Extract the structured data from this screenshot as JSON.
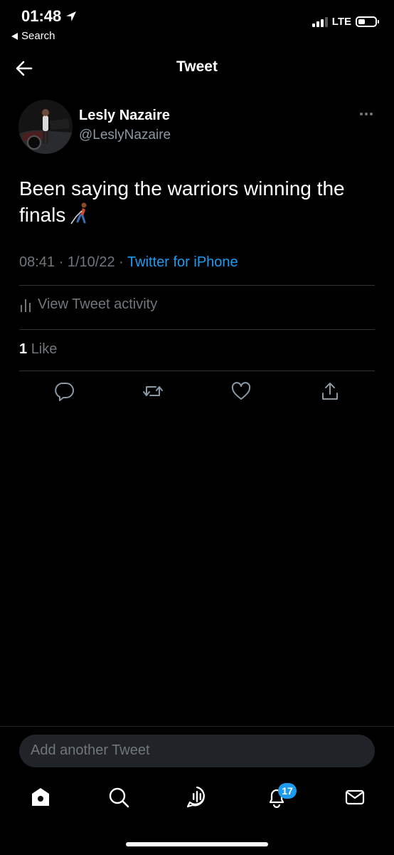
{
  "status_bar": {
    "time": "01:48",
    "back_app": "Search",
    "network": "LTE"
  },
  "header": {
    "title": "Tweet"
  },
  "tweet": {
    "author_name": "Lesly Nazaire",
    "author_handle": "@LeslyNazaire",
    "text": "Been saying the warriors winning the finals",
    "time": "08:41",
    "date": "1/10/22",
    "separator": "·",
    "source": "Twitter for iPhone",
    "activity_label": "View Tweet activity",
    "like_count": "1",
    "like_label": "Like"
  },
  "compose": {
    "placeholder": "Add another Tweet"
  },
  "tabbar": {
    "notifications_badge": "17"
  },
  "colors": {
    "background": "#000000",
    "accent": "#1d9bf0",
    "secondary_text": "#71767b",
    "divider": "#2f3336"
  },
  "icons": [
    "location-arrow-icon",
    "back-arrow-icon",
    "more-icon",
    "person-walking-emoji-icon",
    "analytics-bars-icon",
    "reply-icon",
    "retweet-icon",
    "like-icon",
    "share-icon",
    "home-icon",
    "search-icon",
    "spaces-icon",
    "notifications-icon",
    "messages-icon"
  ]
}
